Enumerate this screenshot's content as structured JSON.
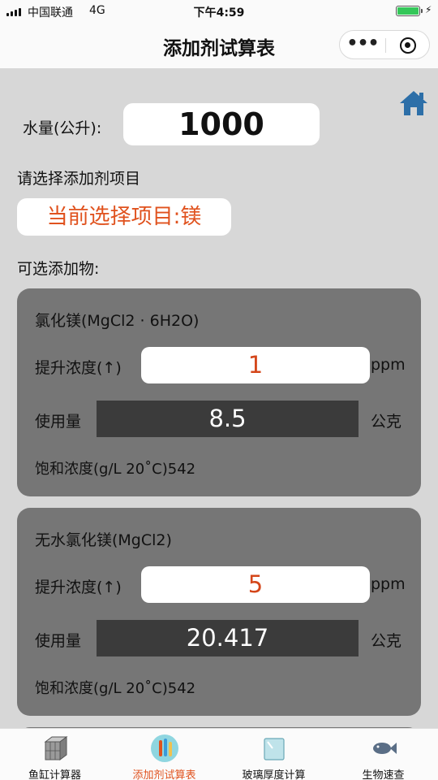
{
  "status_bar": {
    "carrier": "中国联通",
    "network": "4G",
    "time": "下午4:59",
    "battery_fill": 1.0
  },
  "nav": {
    "title": "添加剂试算表",
    "more_label": "•••"
  },
  "water": {
    "label": "水量(公升):",
    "value": "1000"
  },
  "choose_label": "请选择添加剂项目",
  "current_selection": "当前选择项目:镁",
  "addable_label": "可选添加物:",
  "additives": [
    {
      "name": "氯化镁(MgCl2 · 6H2O)",
      "boost_label": "提升浓度(↑)",
      "boost_value": "1",
      "boost_unit": "ppm",
      "usage_label": "使用量",
      "usage_value": "8.5",
      "usage_unit": "公克",
      "saturation": "饱和浓度(g/L 20˚C)542"
    },
    {
      "name": "无水氯化镁(MgCl2)",
      "boost_label": "提升浓度(↑)",
      "boost_value": "5",
      "boost_unit": "ppm",
      "usage_label": "使用量",
      "usage_value": "20.417",
      "usage_unit": "公克",
      "saturation": "饱和浓度(g/L 20˚C)542"
    }
  ],
  "tabs": [
    {
      "label": "鱼缸计算器",
      "icon": "aquarium-icon",
      "active": false
    },
    {
      "label": "添加剂试算表",
      "icon": "dropper-icon",
      "active": true
    },
    {
      "label": "玻璃厚度计算",
      "icon": "glass-icon",
      "active": false
    },
    {
      "label": "生物速查",
      "icon": "fish-icon",
      "active": false
    }
  ],
  "colors": {
    "accent": "#e0521e",
    "home": "#2d6fa8",
    "card": "#767676",
    "usage_box": "#3b3b3b",
    "background": "#d7d7d7"
  }
}
